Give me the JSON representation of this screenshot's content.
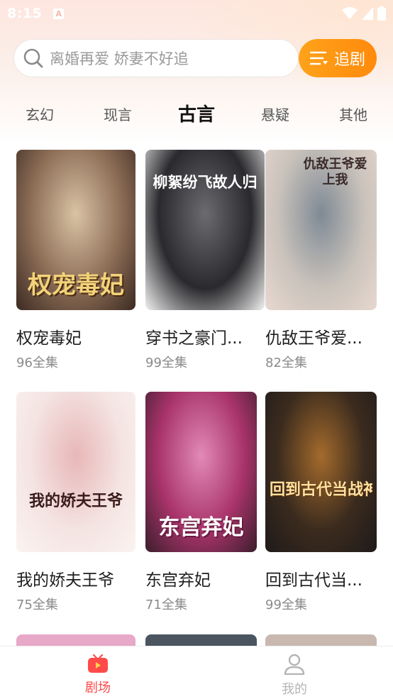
{
  "status_bar": {
    "time": "8:15",
    "notification_letter": "A"
  },
  "search": {
    "placeholder": "离婚再爱 娇妻不好追"
  },
  "follow_button": {
    "label": "追剧"
  },
  "tabs": [
    {
      "label": "玄幻",
      "active": false
    },
    {
      "label": "现言",
      "active": false
    },
    {
      "label": "古言",
      "active": true
    },
    {
      "label": "悬疑",
      "active": false
    },
    {
      "label": "其他",
      "active": false
    }
  ],
  "dramas": [
    {
      "title": "权宠毒妃",
      "episodes": "96全集",
      "poster_text": "权宠毒妃",
      "colors": [
        "#8b6c55",
        "#d9c3a4",
        "#3b2a22"
      ]
    },
    {
      "title": "穿书之豪门...",
      "episodes": "99全集",
      "poster_text": "柳絮纷飞故人归",
      "colors": [
        "#2a2a2e",
        "#6b6b70",
        "#f2f2f2"
      ]
    },
    {
      "title": "仇敌王爷爱...",
      "episodes": "82全集",
      "poster_text": "仇敌王爷爱上我",
      "colors": [
        "#c9c2bb",
        "#7f8a95",
        "#e8d8cf"
      ]
    },
    {
      "title": "我的娇夫王爷",
      "episodes": "75全集",
      "poster_text": "我的娇夫王爷",
      "colors": [
        "#f4e4e2",
        "#e8b7b8",
        "#fbf3f1"
      ]
    },
    {
      "title": "东宫弃妃",
      "episodes": "71全集",
      "poster_text": "东宫弃妃",
      "colors": [
        "#a8336a",
        "#e28ab7",
        "#3a1e2c"
      ]
    },
    {
      "title": "回到古代当...",
      "episodes": "99全集",
      "poster_text": "回到古代当战神",
      "colors": [
        "#3b2b1e",
        "#a46b2c",
        "#1e1a1a"
      ]
    }
  ],
  "peek_colors": [
    "#e8a8c8",
    "#4a5560",
    "#c8b8b0"
  ],
  "bottom_nav": [
    {
      "label": "剧场",
      "active": true,
      "color": "#ff4a4a"
    },
    {
      "label": "我的",
      "active": false,
      "color": "#b5b5b5"
    }
  ],
  "accent_color": "#ff9414"
}
